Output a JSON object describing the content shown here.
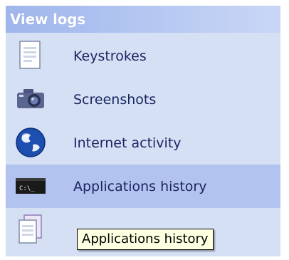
{
  "panel": {
    "title": "View logs",
    "items": [
      {
        "label": "Keystrokes",
        "icon": "document-icon"
      },
      {
        "label": "Screenshots",
        "icon": "camera-icon"
      },
      {
        "label": "Internet activity",
        "icon": "globe-icon"
      },
      {
        "label": "Applications history",
        "icon": "console-icon",
        "active": true
      },
      {
        "label": "",
        "icon": "documents-icon"
      }
    ]
  },
  "tooltip": {
    "text": "Applications history"
  },
  "colors": {
    "panel_bg": "#d6e0f5",
    "header_bg": "#9fb6ec",
    "active_row_bg": "#b2c3ef",
    "label_text": "#1a2660",
    "tooltip_bg": "#ffffe1"
  }
}
